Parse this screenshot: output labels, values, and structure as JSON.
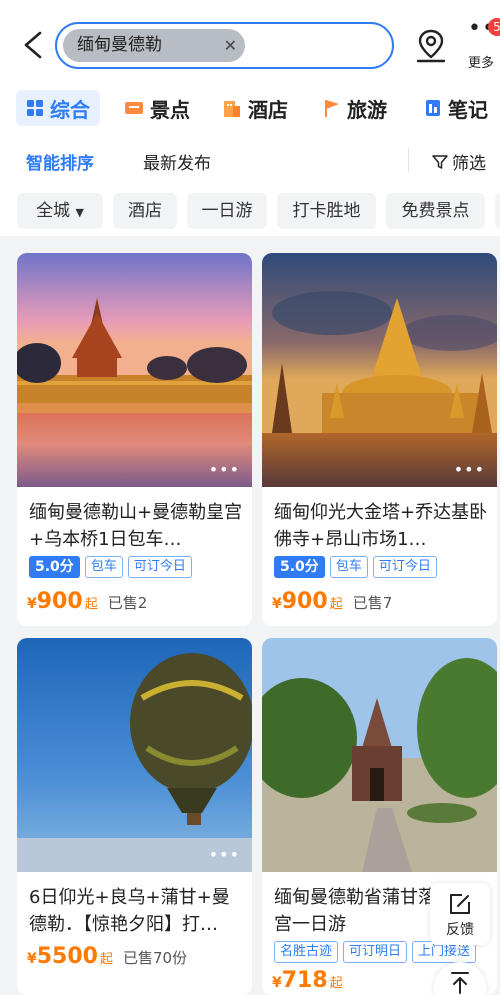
{
  "search": {
    "query": "缅甸曼德勒"
  },
  "header": {
    "more_label": "更多",
    "more_badge": "5"
  },
  "categories": [
    {
      "label": "综合",
      "icon": "grid-icon"
    },
    {
      "label": "景点",
      "icon": "ticket-icon"
    },
    {
      "label": "酒店",
      "icon": "hotel-icon"
    },
    {
      "label": "旅游",
      "icon": "flag-icon"
    },
    {
      "label": "笔记",
      "icon": "notebook-icon"
    }
  ],
  "sort": {
    "smart": "智能排序",
    "latest": "最新发布",
    "filter": "筛选"
  },
  "tags": [
    "全城",
    "酒店",
    "一日游",
    "打卡胜地",
    "免费景点"
  ],
  "colors": {
    "accent": "#2f7cf6",
    "price": "#ff7a00",
    "badge_red": "#f0403c"
  },
  "cards": [
    {
      "title": "缅甸曼德勒山+曼德勒皇宫+乌本桥1日包车…",
      "score": "5.0分",
      "tags": [
        "包车",
        "可订今日"
      ],
      "currency": "¥",
      "price": "900",
      "suffix": "起",
      "sold": "已售2"
    },
    {
      "title": "缅甸仰光大金塔+乔达基卧佛寺+昂山市场1…",
      "score": "5.0分",
      "tags": [
        "包车",
        "可订今日"
      ],
      "currency": "¥",
      "price": "900",
      "suffix": "起",
      "sold": "已售7"
    },
    {
      "title": "6日仰光+良乌+蒲甘+曼德勒．【惊艳夕阳】打…",
      "currency": "¥",
      "price": "5500",
      "suffix": "起",
      "sold": "已售70份"
    },
    {
      "title": "缅甸曼德勒省蒲甘落金皇宫一日游",
      "tags": [
        "名胜古迹",
        "可订明日",
        "上门接送"
      ],
      "currency": "¥",
      "price": "718",
      "suffix": "起"
    }
  ],
  "floating": {
    "feedback": "反馈"
  }
}
